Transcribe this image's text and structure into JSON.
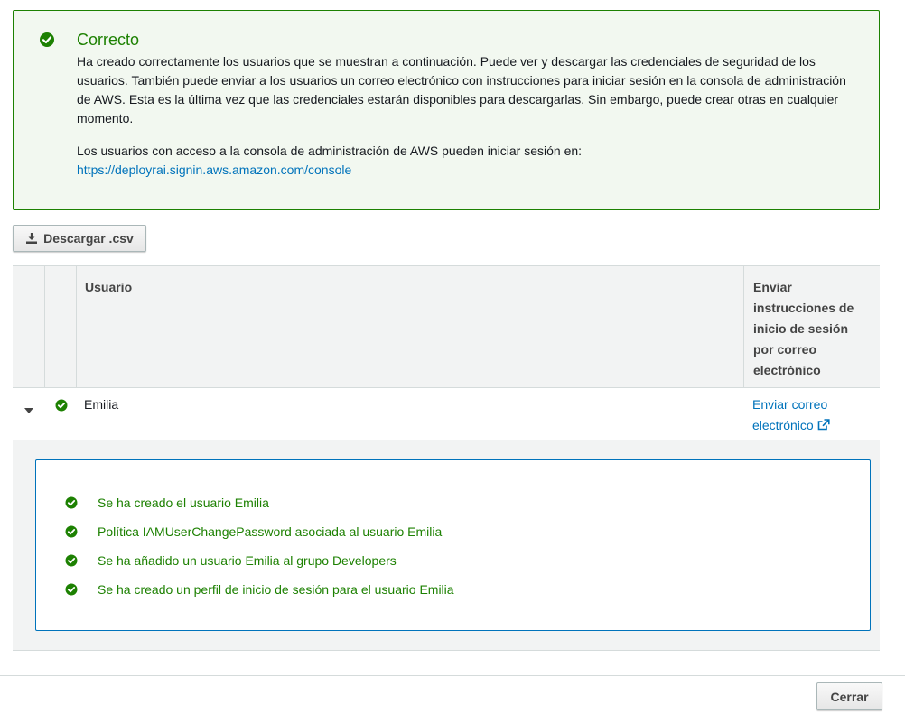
{
  "alert": {
    "title": "Correcto",
    "message": "Ha creado correctamente los usuarios que se muestran a continuación. Puede ver y descargar las credenciales de seguridad de los usuarios. También puede enviar a los usuarios un correo electrónico con instrucciones para iniciar sesión en la consola de administración de AWS. Esta es la última vez que las credenciales estarán disponibles para descargarlas. Sin embargo, puede crear otras en cualquier momento.",
    "console_text": "Los usuarios con acceso a la consola de administración de AWS pueden iniciar sesión en:",
    "console_url": "https://deployrai.signin.aws.amazon.com/console"
  },
  "toolbar": {
    "download_label": "Descargar .csv"
  },
  "table": {
    "columns": {
      "user": "Usuario",
      "email": "Enviar instrucciones de inicio de sesión por correo electrónico"
    },
    "rows": [
      {
        "user": "Emilia",
        "email_link": "Enviar correo electrónico",
        "details": [
          "Se ha creado el usuario Emilia",
          "Política IAMUserChangePassword asociada al usuario Emilia",
          "Se ha añadido un usuario Emilia al grupo Developers",
          "Se ha creado un perfil de inicio de sesión para el usuario Emilia"
        ]
      }
    ]
  },
  "footer": {
    "close_label": "Cerrar"
  },
  "colors": {
    "success": "#1d8102",
    "link": "#0073bb",
    "header_bg": "#f2f3f3"
  }
}
